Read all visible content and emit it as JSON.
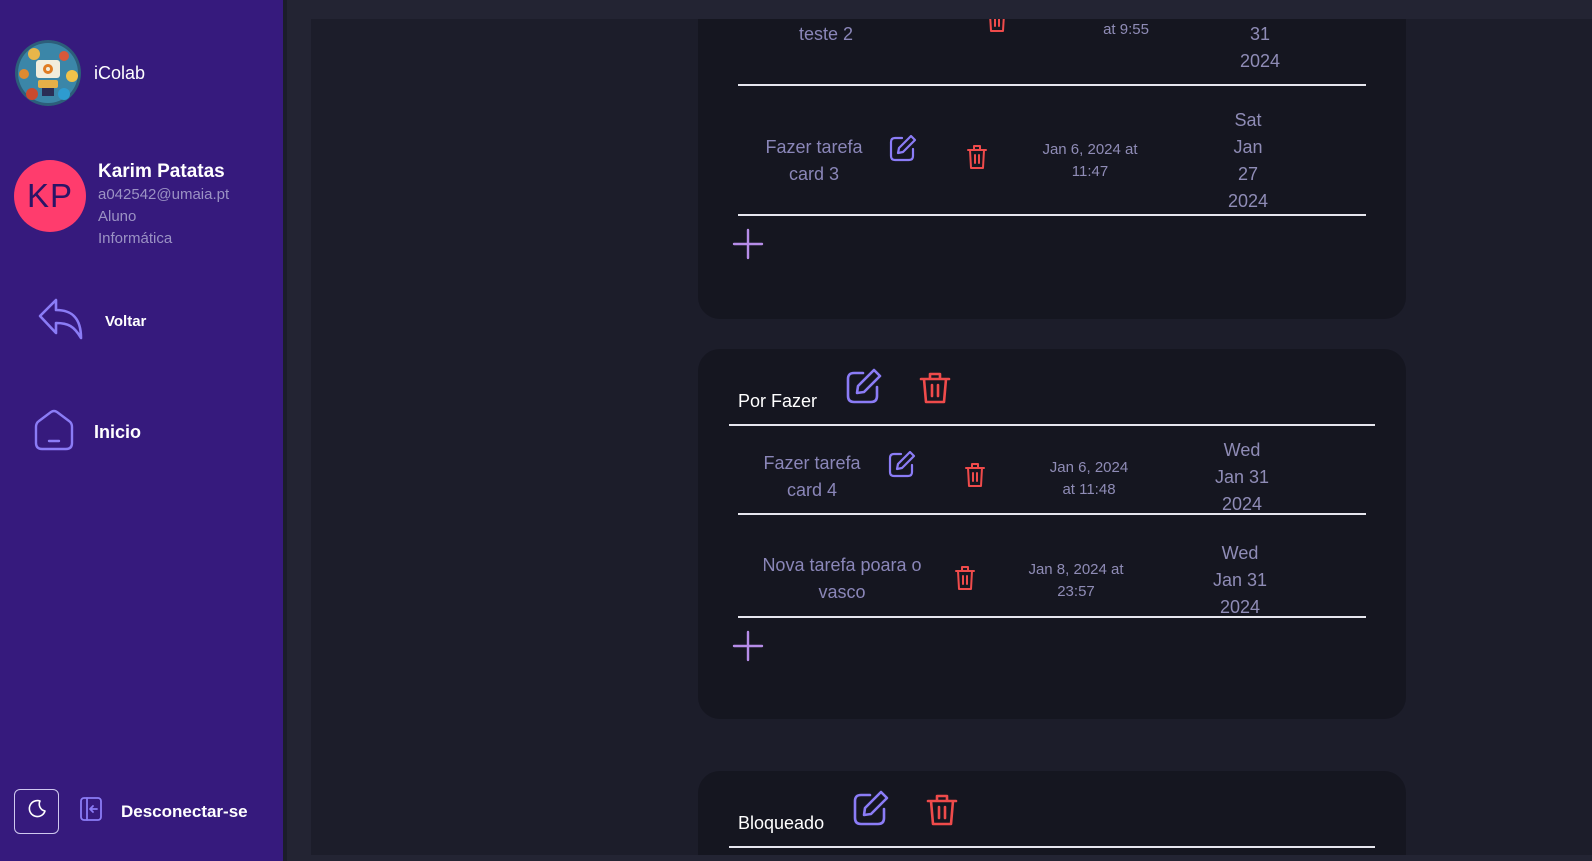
{
  "app": {
    "name": "iColab"
  },
  "user": {
    "initials": "KP",
    "name": "Karim Patatas",
    "email": "a042542@umaia.pt",
    "role": "Aluno",
    "course": "Informática"
  },
  "nav": {
    "back_label": "Voltar",
    "home_label": "Inicio",
    "logout_label": "Desconectar-se"
  },
  "boards": [
    {
      "rows": [
        {
          "title_lines": [
            "teste 2"
          ],
          "created_lines": [
            "at 9:55"
          ],
          "due_lines": [
            "31",
            "2024"
          ]
        },
        {
          "title_lines": [
            "Fazer tarefa",
            "card 3"
          ],
          "created_lines": [
            "Jan 6, 2024 at",
            "11:47"
          ],
          "due_lines": [
            "Sat",
            "Jan",
            "27",
            "2024"
          ]
        }
      ]
    },
    {
      "title": "Por Fazer",
      "rows": [
        {
          "title_lines": [
            "Fazer tarefa",
            "card 4"
          ],
          "created_lines": [
            "Jan 6, 2024",
            "at 11:48"
          ],
          "due_lines": [
            "Wed",
            "Jan 31",
            "2024"
          ]
        },
        {
          "title_lines": [
            "Nova tarefa poara o",
            "vasco"
          ],
          "created_lines": [
            "Jan 8, 2024 at",
            "23:57"
          ],
          "due_lines": [
            "Wed",
            "Jan 31",
            "2024"
          ]
        }
      ]
    },
    {
      "title": "Bloqueado"
    }
  ],
  "colors": {
    "sidebar": "#361a7d",
    "accent": "#8b7cf6",
    "danger": "#ef4b4b",
    "avatar": "#ff3c6d",
    "plus": "#b68ce8"
  }
}
